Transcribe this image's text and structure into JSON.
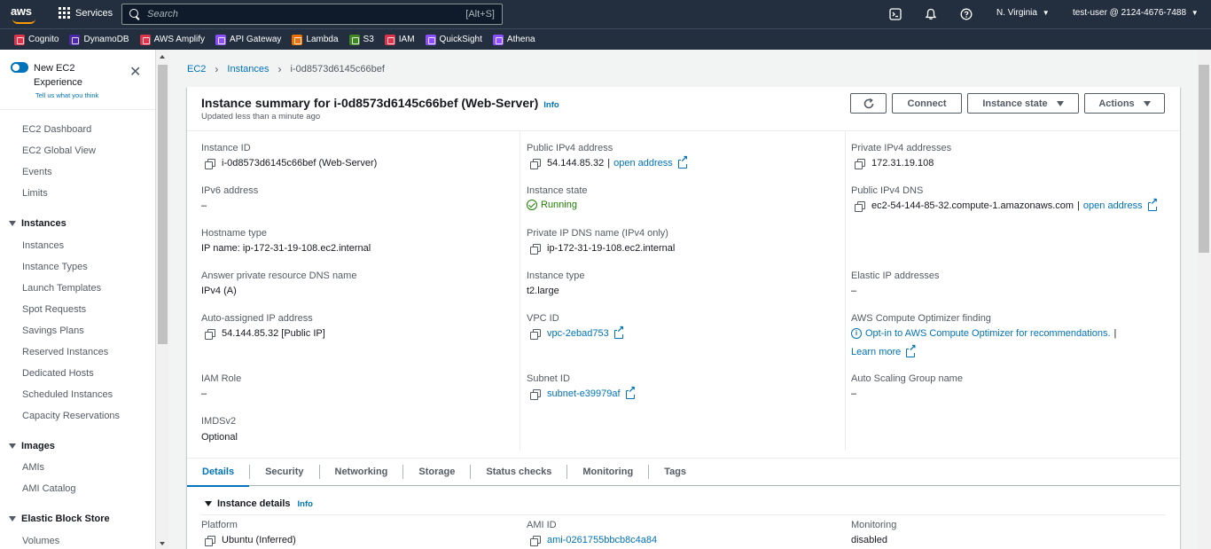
{
  "topnav": {
    "logo": "aws",
    "services_label": "Services",
    "search_placeholder": "Search",
    "search_shortcut": "[Alt+S]",
    "icons": [
      "cloudshell-icon",
      "bell-icon",
      "help-icon"
    ],
    "region": "N. Virginia",
    "user": "test-user @ 2124-4676-7488"
  },
  "favorites": [
    {
      "label": "Cognito",
      "color": "#dd344c"
    },
    {
      "label": "DynamoDB",
      "color": "#4d27aa"
    },
    {
      "label": "AWS Amplify",
      "color": "#dd344c"
    },
    {
      "label": "API Gateway",
      "color": "#8c4fff"
    },
    {
      "label": "Lambda",
      "color": "#ed7100"
    },
    {
      "label": "S3",
      "color": "#3f8624"
    },
    {
      "label": "IAM",
      "color": "#dd344c"
    },
    {
      "label": "QuickSight",
      "color": "#8c4fff"
    },
    {
      "label": "Athena",
      "color": "#8c4fff"
    }
  ],
  "sidebar": {
    "toggle_label": "New EC2 Experience",
    "toggle_link": "Tell us what you think",
    "top_links": [
      "EC2 Dashboard",
      "EC2 Global View",
      "Events",
      "Limits"
    ],
    "sections": [
      {
        "title": "Instances",
        "items": [
          "Instances",
          "Instance Types",
          "Launch Templates",
          "Spot Requests",
          "Savings Plans",
          "Reserved Instances",
          "Dedicated Hosts",
          "Scheduled Instances",
          "Capacity Reservations"
        ]
      },
      {
        "title": "Images",
        "items": [
          "AMIs",
          "AMI Catalog"
        ]
      },
      {
        "title": "Elastic Block Store",
        "items": [
          "Volumes"
        ]
      }
    ]
  },
  "breadcrumb": {
    "items": [
      "EC2",
      "Instances"
    ],
    "current": "i-0d8573d6145c66bef"
  },
  "summary": {
    "title": "Instance summary for i-0d8573d6145c66bef (Web-Server)",
    "info": "Info",
    "subtitle": "Updated less than a minute ago",
    "buttons": {
      "connect": "Connect",
      "instance_state": "Instance state",
      "actions": "Actions"
    },
    "fields": {
      "instance_id": {
        "label": "Instance ID",
        "value": "i-0d8573d6145c66bef (Web-Server)"
      },
      "ipv6": {
        "label": "IPv6 address",
        "value": "–"
      },
      "hostname_type": {
        "label": "Hostname type",
        "value": "IP name: ip-172-31-19-108.ec2.internal"
      },
      "answer_dns": {
        "label": "Answer private resource DNS name",
        "value": "IPv4 (A)"
      },
      "auto_ip": {
        "label": "Auto-assigned IP address",
        "value": "54.144.85.32 [Public IP]"
      },
      "iam_role": {
        "label": "IAM Role",
        "value": "–"
      },
      "imdsv2": {
        "label": "IMDSv2",
        "value": "Optional"
      },
      "public_ipv4": {
        "label": "Public IPv4 address",
        "value": "54.144.85.32",
        "link": "open address"
      },
      "instance_state": {
        "label": "Instance state",
        "value": "Running"
      },
      "private_dns": {
        "label": "Private IP DNS name (IPv4 only)",
        "value": "ip-172-31-19-108.ec2.internal"
      },
      "instance_type": {
        "label": "Instance type",
        "value": "t2.large"
      },
      "vpc_id": {
        "label": "VPC ID",
        "value": "vpc-2ebad753"
      },
      "subnet_id": {
        "label": "Subnet ID",
        "value": "subnet-e39979af"
      },
      "private_ipv4": {
        "label": "Private IPv4 addresses",
        "value": "172.31.19.108"
      },
      "public_dns": {
        "label": "Public IPv4 DNS",
        "value": "ec2-54-144-85-32.compute-1.amazonaws.com",
        "link": "open address"
      },
      "elastic_ip": {
        "label": "Elastic IP addresses",
        "value": "–"
      },
      "optimizer": {
        "label": "AWS Compute Optimizer finding",
        "value": "Opt-in to AWS Compute Optimizer for recommendations.",
        "learn_more": "Learn more"
      },
      "asg": {
        "label": "Auto Scaling Group name",
        "value": "–"
      }
    }
  },
  "tabs": [
    "Details",
    "Security",
    "Networking",
    "Storage",
    "Status checks",
    "Monitoring",
    "Tags"
  ],
  "details": {
    "title": "Instance details",
    "info": "Info",
    "platform": {
      "label": "Platform",
      "value": "Ubuntu (Inferred)"
    },
    "ami_id": {
      "label": "AMI ID",
      "value": "ami-0261755bbcb8c4a84"
    },
    "monitoring": {
      "label": "Monitoring",
      "value": "disabled"
    }
  }
}
